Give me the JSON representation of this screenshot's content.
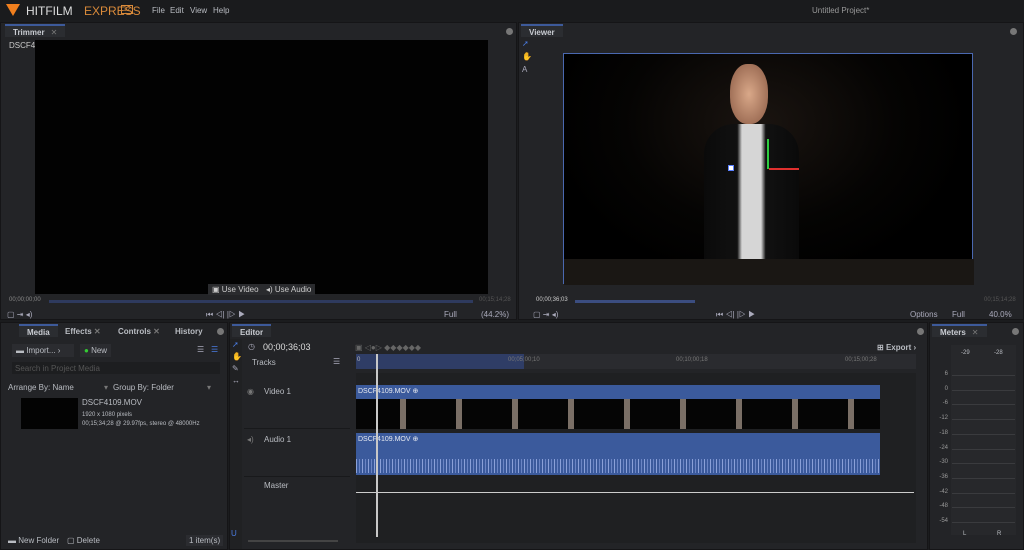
{
  "app": {
    "brand": "HITFILM",
    "edition": "EXPRESS",
    "badge": "12",
    "project_title": "Untitled Project*",
    "accent": "#3d5a9a",
    "logo_color": "#f07f1e"
  },
  "menu": [
    "File",
    "Edit",
    "View",
    "Help"
  ],
  "trimmer": {
    "tab": "Trimmer",
    "file": "DSCF4109.MOV",
    "use_video": "Use Video",
    "use_audio": "Use Audio",
    "time_start": "00;00;00;00",
    "time_end": "00;15;14;28",
    "quality": "Full",
    "zoom": "(44.2%)"
  },
  "viewer": {
    "tab": "Viewer",
    "time": "00;00;36;03",
    "time_end": "00;15;14;28",
    "options": "Options",
    "quality": "Full",
    "zoom": "40.0%",
    "progress": 0.04
  },
  "media": {
    "tabs": [
      "Media",
      "Effects",
      "Controls",
      "History"
    ],
    "import": "Import...",
    "new": "New",
    "search_placeholder": "Search in Project Media",
    "arrange": "Arrange By: Name",
    "group": "Group By: Folder",
    "item": {
      "name": "DSCF4109.MOV",
      "dims": "1920 x 1080 pixels",
      "info": "00;15;34;28 @ 29.97fps, stereo @ 48000Hz"
    },
    "new_folder": "New Folder",
    "delete": "Delete",
    "count": "1 item(s)"
  },
  "editor": {
    "tab": "Editor",
    "timecode": "00;00;36;03",
    "export": "Export",
    "tracks_label": "Tracks",
    "ruler": [
      "0",
      "00;05;00;10",
      "00;10;00;18",
      "00;15;00;28"
    ],
    "tracks": [
      {
        "name": "Video 1",
        "clip": "DSCF4109.MOV ⊕"
      },
      {
        "name": "Audio 1",
        "clip": "DSCF4109.MOV ⊕"
      },
      {
        "name": "Master"
      }
    ]
  },
  "meters": {
    "tab": "Meters",
    "peaks": [
      "-29",
      "-28"
    ],
    "scale": [
      "6",
      "0",
      "-6",
      "-12",
      "-18",
      "-24",
      "-30",
      "-36",
      "-42",
      "-48",
      "-54"
    ],
    "channels": [
      "L",
      "R"
    ]
  }
}
